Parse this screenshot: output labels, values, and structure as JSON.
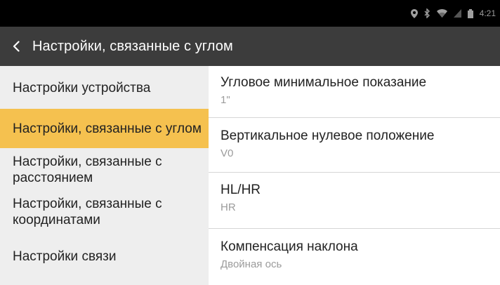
{
  "status_bar": {
    "time": "4:21",
    "icons": [
      "location-icon",
      "bluetooth-icon",
      "wifi-icon",
      "signal-icon",
      "battery-icon"
    ]
  },
  "header": {
    "title": "Настройки, связанные с углом",
    "back_icon": "chevron-left-icon"
  },
  "sidebar": {
    "items": [
      {
        "label": "Настройки устройства",
        "active": false
      },
      {
        "label": "Настройки, связанные с углом",
        "active": true
      },
      {
        "label": "Настройки, связанные с расстоянием",
        "active": false
      },
      {
        "label": "Настройки, связанные с координатами",
        "active": false
      },
      {
        "label": "Настройки связи",
        "active": false
      }
    ]
  },
  "settings": [
    {
      "label": "Угловое минимальное показание",
      "value": "1\""
    },
    {
      "label": "Вертикальное нулевое положение",
      "value": "V0"
    },
    {
      "label": "HL/HR",
      "value": "HR"
    },
    {
      "label": "Компенсация наклона",
      "value": "Двойная ось"
    }
  ],
  "colors": {
    "status_bar": "#000000",
    "title_bar": "#3c3c3c",
    "sidebar_bg": "#eeeeee",
    "active_item": "#f5c14f",
    "value_text": "#9b9b9b"
  }
}
